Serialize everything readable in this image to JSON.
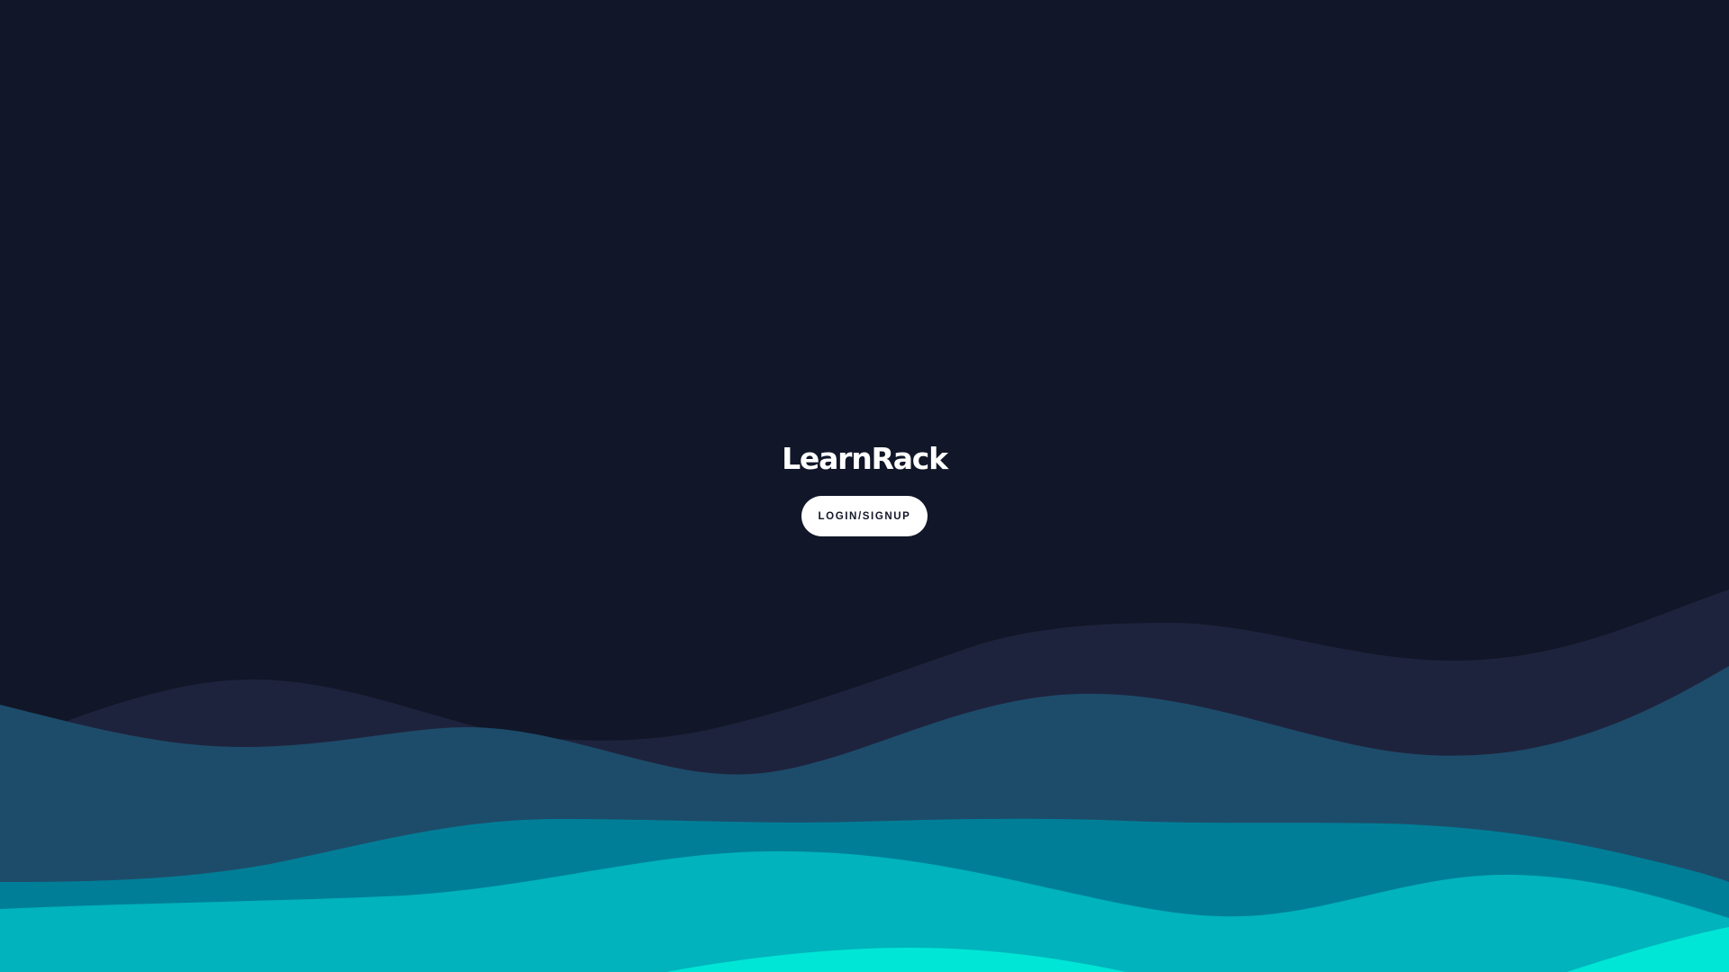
{
  "brand": {
    "name": "LearnRack"
  },
  "actions": {
    "login_label": "LOGIN/SIGNUP"
  },
  "colors": {
    "background": "#111628",
    "wave_1": "#1e233d",
    "wave_2": "#1d4c6a",
    "wave_3": "#007e98",
    "wave_4": "#00b3bc",
    "wave_5": "#00e6d6",
    "button_bg": "#ffffff",
    "button_text": "#111628"
  }
}
